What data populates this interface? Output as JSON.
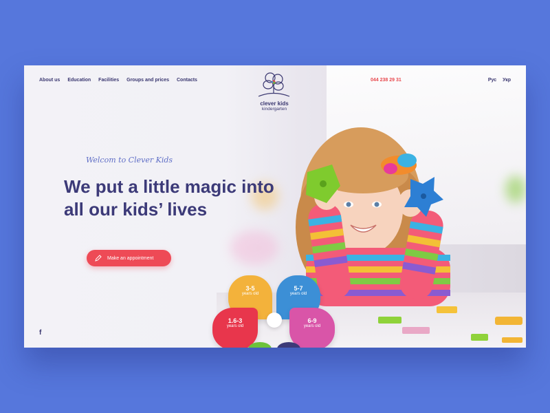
{
  "nav": {
    "items": [
      {
        "label": "About us"
      },
      {
        "label": "Education"
      },
      {
        "label": "Facilities"
      },
      {
        "label": "Groups and prices"
      },
      {
        "label": "Contacts"
      }
    ]
  },
  "logo": {
    "name": "clever kids",
    "sub": "kindergarten"
  },
  "phone": "044 238 29 31",
  "lang": [
    "Рус",
    "Укр"
  ],
  "hero": {
    "welcome": "Welcom to Clever Kids",
    "headline": "We put a little magic into all our kids’ lives",
    "cta": "Make an appointment"
  },
  "social": {
    "facebook": "f"
  },
  "groups": [
    {
      "age": "3-5",
      "label": "years old",
      "color": "#f3b23b"
    },
    {
      "age": "5-7",
      "label": "years old",
      "color": "#3c8fd6"
    },
    {
      "age": "1.6-3",
      "label": "years old",
      "color": "#e8364c"
    },
    {
      "age": "6-9",
      "label": "years old",
      "color": "#d955a8"
    }
  ],
  "colors": {
    "background": "#5677dc",
    "accent": "#ee4a56",
    "heading": "#3c3a78"
  }
}
